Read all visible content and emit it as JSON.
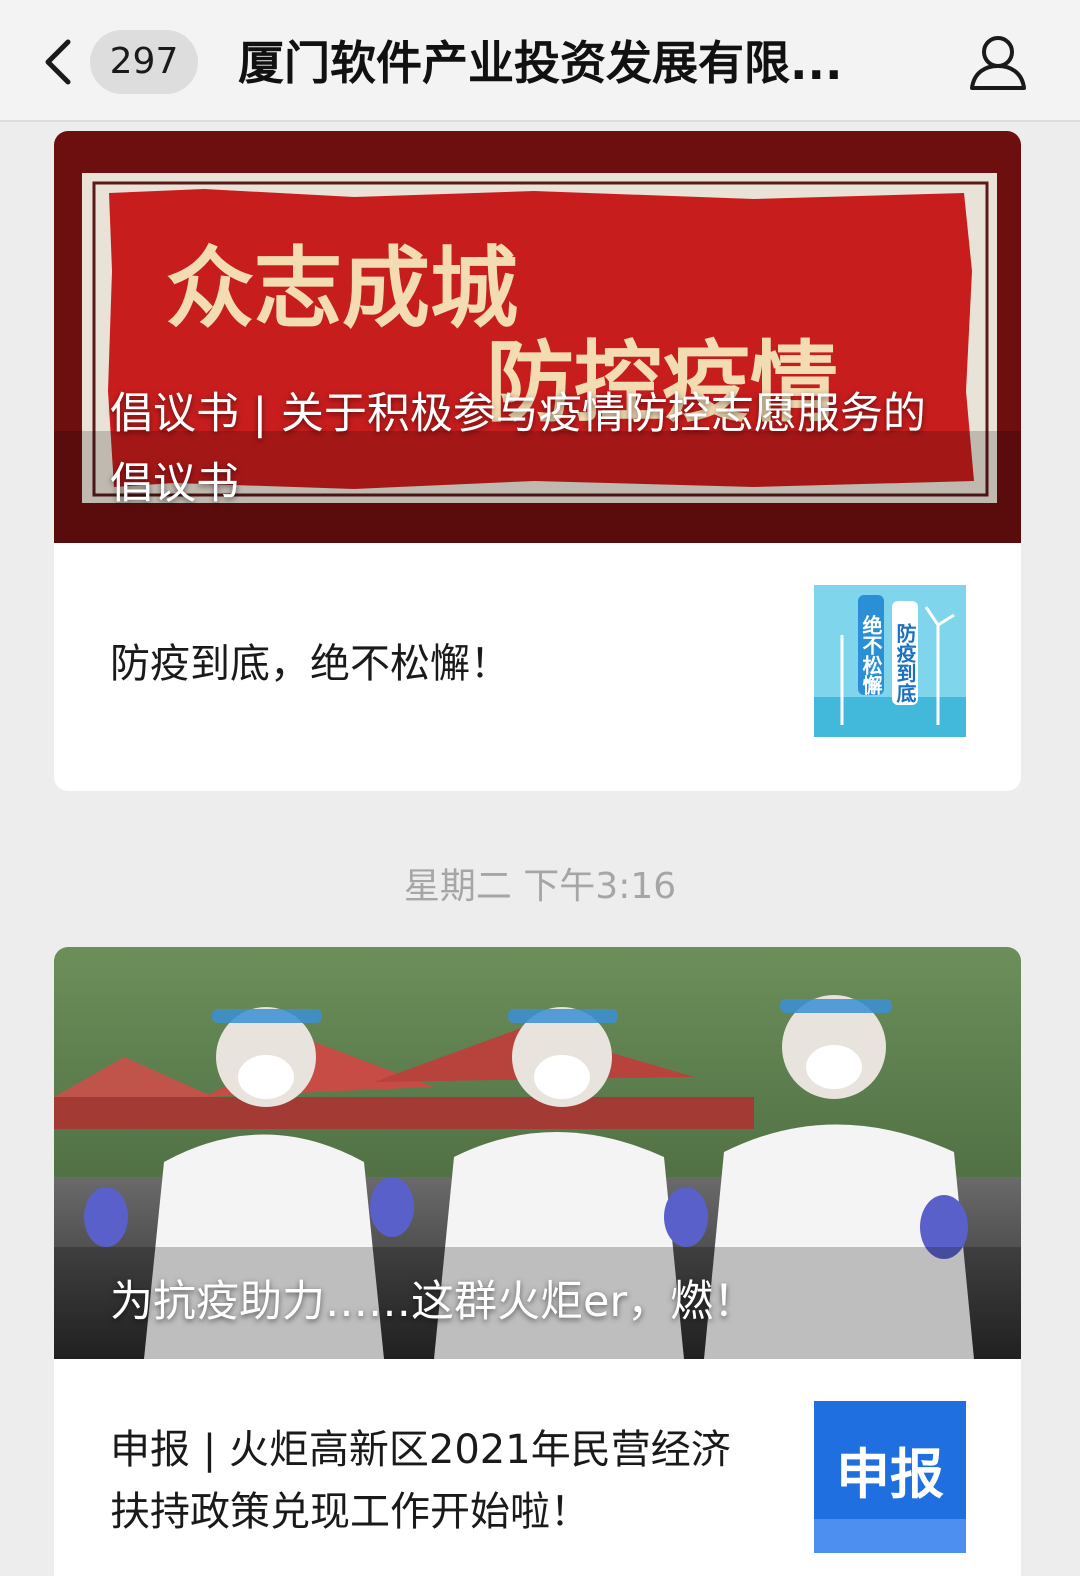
{
  "header": {
    "back_icon": "chevron-left-icon",
    "unread_count": "297",
    "title": "厦门软件产业投资发展有限...",
    "profile_icon": "user-icon"
  },
  "cards": [
    {
      "cover": {
        "banner_line1": "众志成城",
        "banner_line2": "防控疫情",
        "title": "倡议书 | 关于积极参与疫情防控志愿服务的倡议书"
      },
      "item": {
        "text": "防疫到底，绝不松懈！",
        "thumb_line1": "防疫到底",
        "thumb_line2": "绝不松懈"
      }
    },
    {
      "cover": {
        "title": "为抗疫助力……这群火炬er，燃！"
      },
      "item": {
        "text": "申报 | 火炬高新区2021年民营经济扶持政策兑现工作开始啦！",
        "thumb_text": "申报"
      }
    }
  ],
  "timestamp": "星期二 下午3:16",
  "colors": {
    "banner_red": "#b01717",
    "banner_text": "#f3dcb2",
    "thumb_blue": "#1f6fe0"
  }
}
